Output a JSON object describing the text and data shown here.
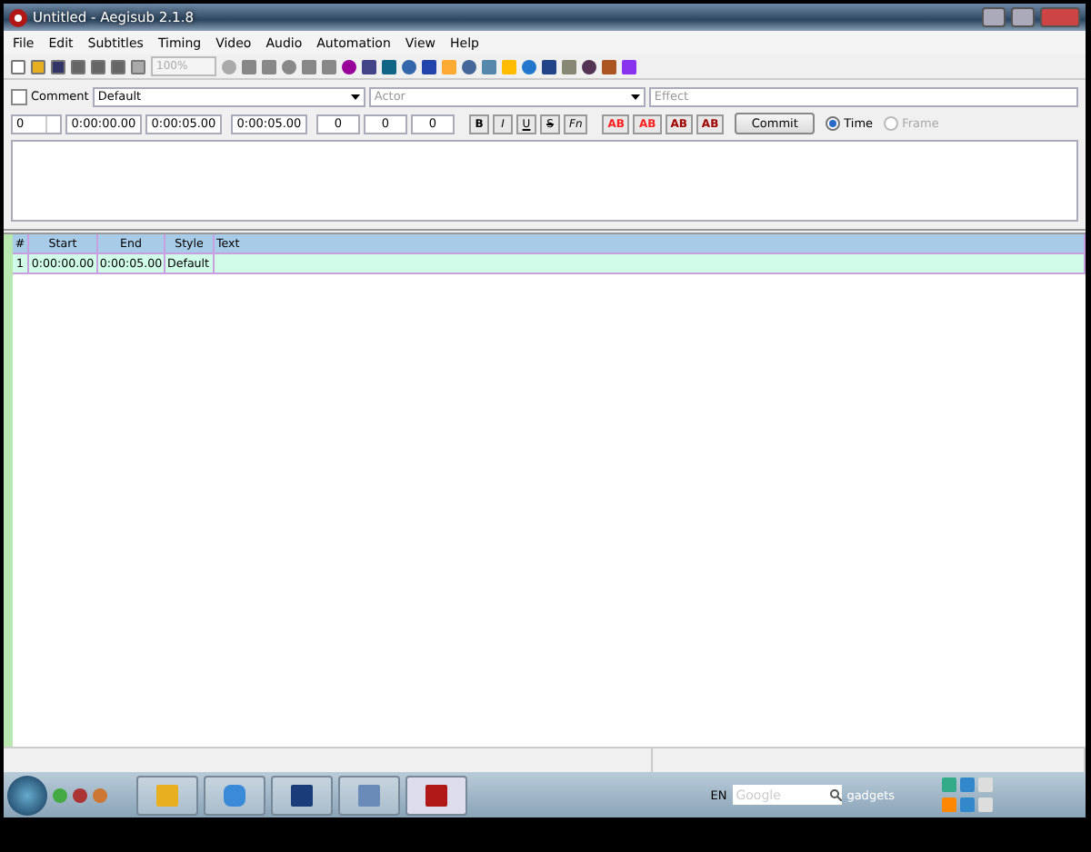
{
  "window": {
    "title": "Untitled - Aegisub 2.1.8"
  },
  "menu": [
    "File",
    "Edit",
    "Subtitles",
    "Timing",
    "Video",
    "Audio",
    "Automation",
    "View",
    "Help"
  ],
  "toolbar": {
    "zoom": {
      "value": "100%",
      "disabled": true
    }
  },
  "edit": {
    "comment": {
      "label": "Comment",
      "checked": false
    },
    "style": "Default",
    "actor": {
      "placeholder": "Actor"
    },
    "effect": {
      "placeholder": "Effect"
    },
    "layer": "0",
    "start": "0:00:00.00",
    "end": "0:00:05.00",
    "duration": "0:00:05.00",
    "margins": [
      "0",
      "0",
      "0"
    ],
    "format_buttons": [
      {
        "kind": "bold",
        "label": "B"
      },
      {
        "kind": "italic",
        "label": "I"
      },
      {
        "kind": "underline",
        "label": "U"
      },
      {
        "kind": "strike",
        "label": "S"
      },
      {
        "kind": "font",
        "label": "Fn"
      }
    ],
    "color_buttons": [
      {
        "label": "AB",
        "color": "#ff2020"
      },
      {
        "label": "AB",
        "color": "#ff2020"
      },
      {
        "label": "AB",
        "color": "#a00000"
      },
      {
        "label": "AB",
        "color": "#a00000"
      }
    ],
    "commit": "Commit",
    "modes": [
      {
        "label": "Time",
        "selected": true,
        "disabled": false
      },
      {
        "label": "Frame",
        "selected": false,
        "disabled": true
      }
    ]
  },
  "grid": {
    "columns": [
      "#",
      "Start",
      "End",
      "Style",
      "Text"
    ],
    "rows": [
      {
        "number": "1",
        "start": "0:00:00.00",
        "end": "0:00:05.00",
        "style": "Default",
        "selected": true
      }
    ]
  },
  "taskbar": {
    "language": "EN",
    "search": {
      "placeholder": "Google"
    },
    "gadgets": "gadgets"
  }
}
